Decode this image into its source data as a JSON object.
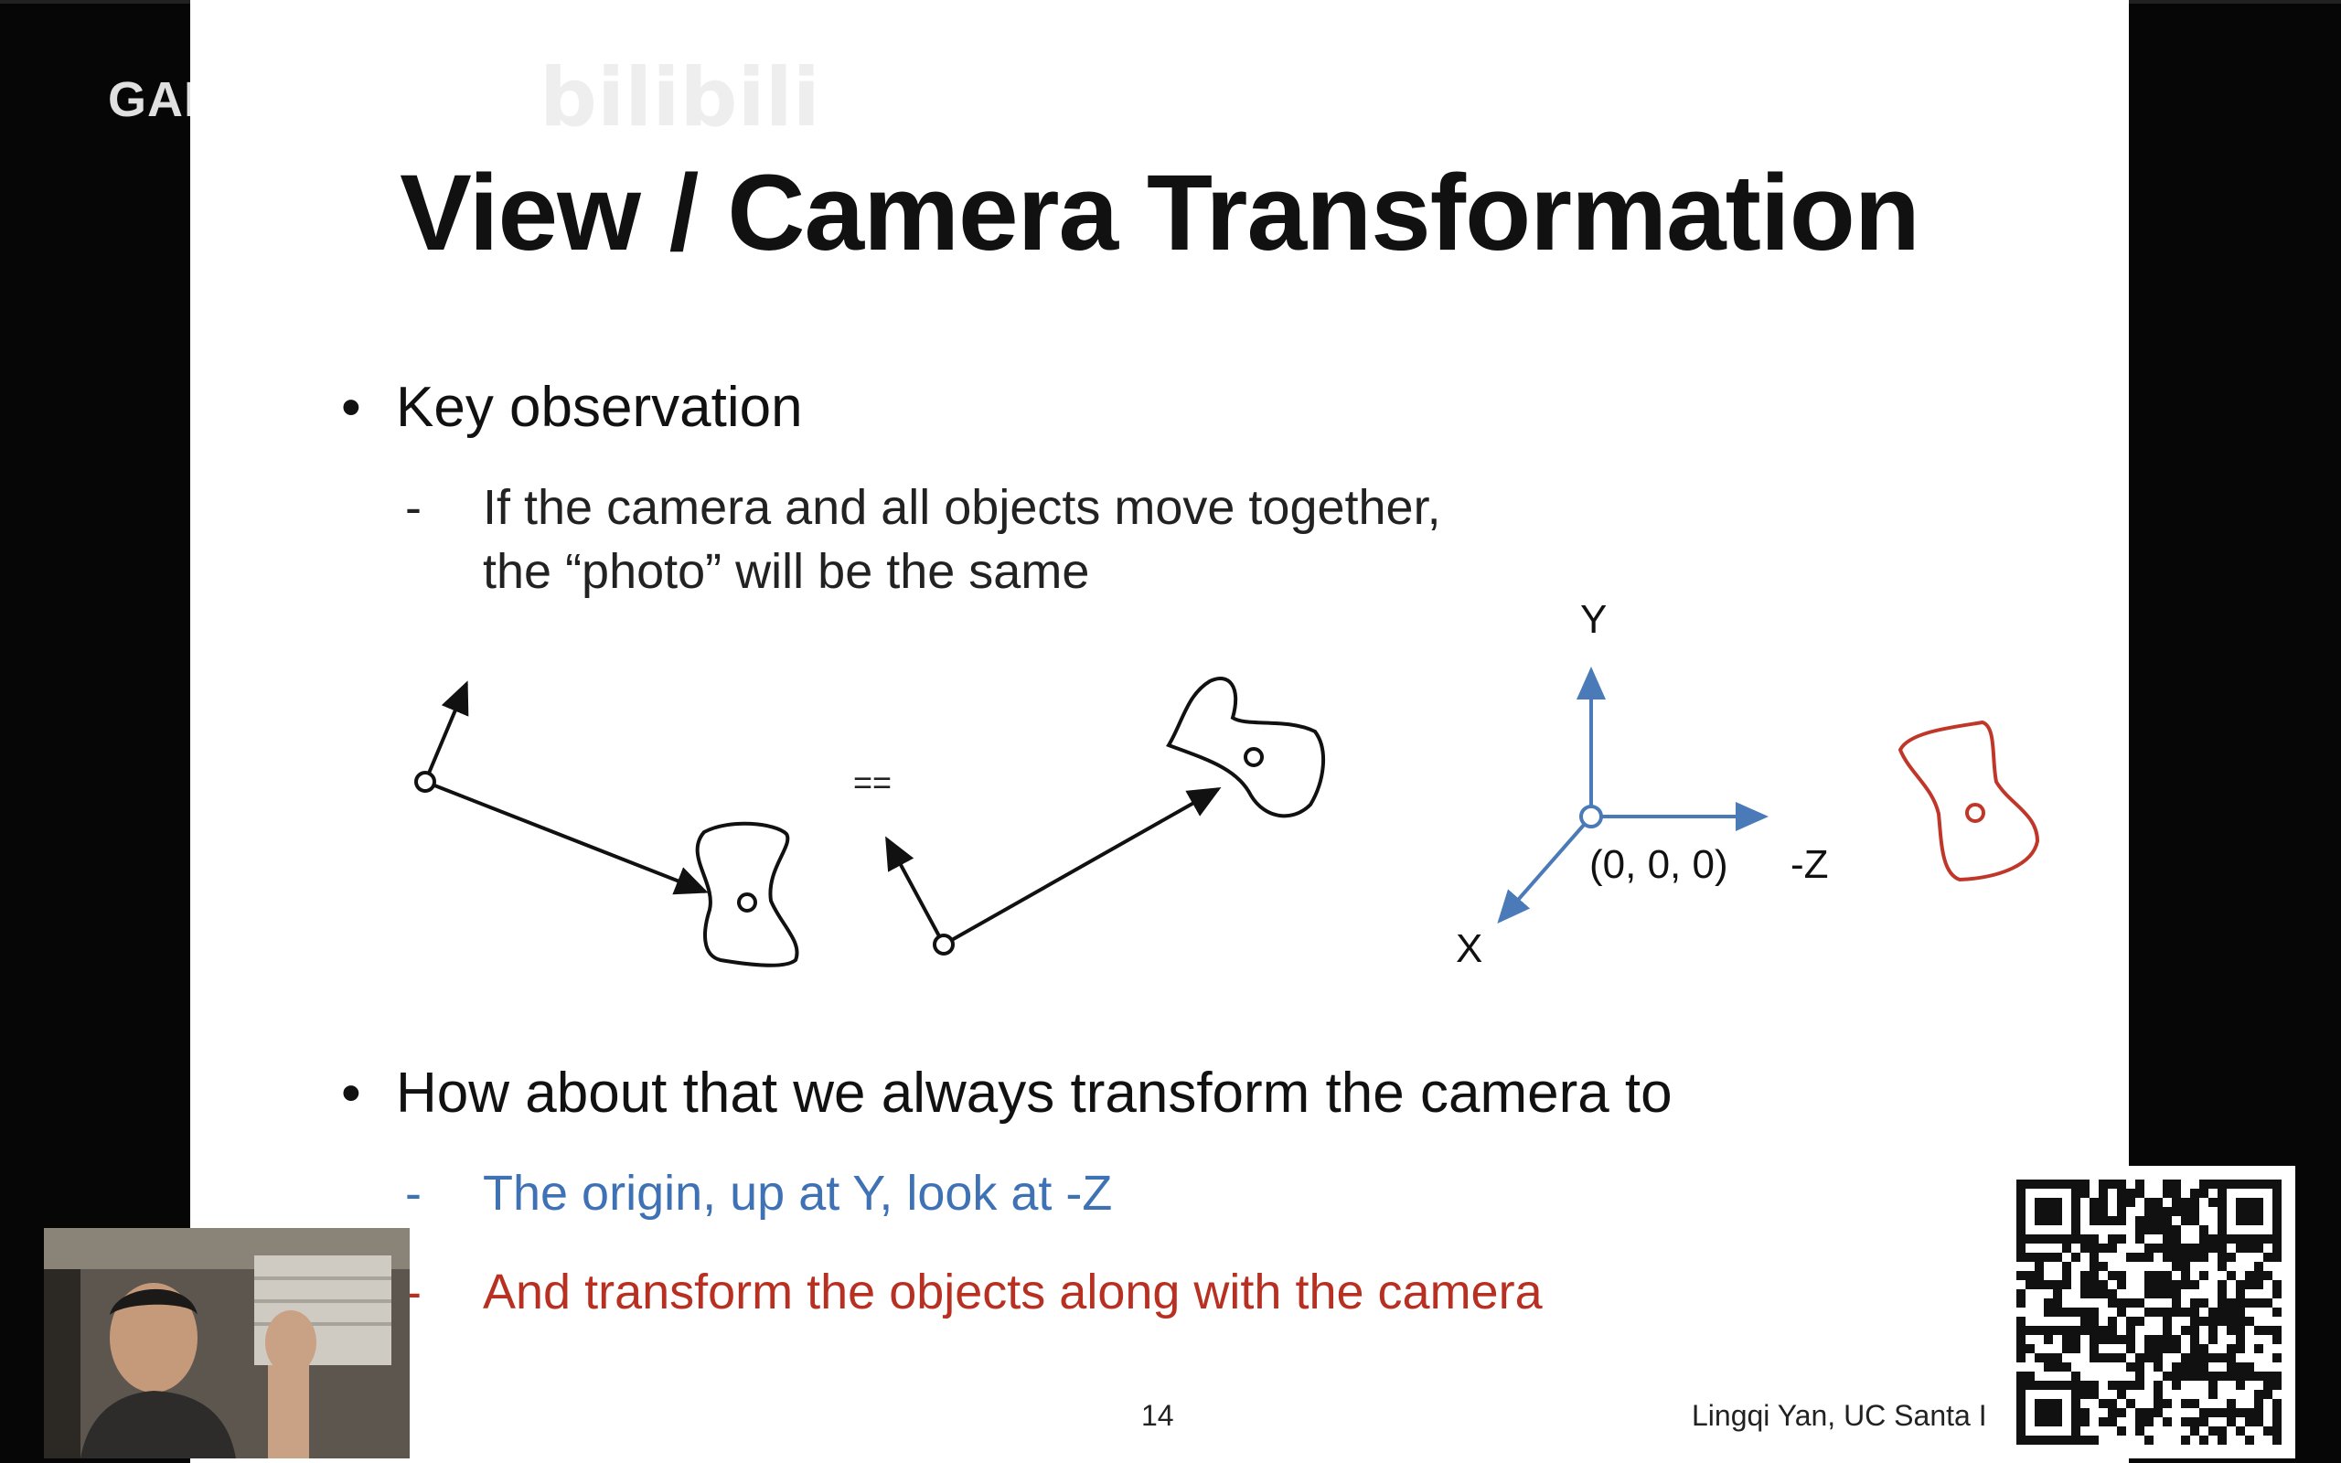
{
  "watermark": {
    "text": "GAMES-Webinar",
    "logo": "bilibili"
  },
  "slide": {
    "title": "View / Camera Transformation",
    "bullet1": "Key observation",
    "sub1_line1": "If the camera and all objects move together,",
    "sub1_line2": "the “photo” will be the same",
    "diagram": {
      "equals": "==",
      "axis_y": "Y",
      "axis_z": "-Z",
      "axis_x": "X",
      "origin": "(0, 0, 0)",
      "colors": {
        "axes": "#4a7ab8",
        "object_red": "#c0372a",
        "ink": "#111111"
      }
    },
    "bullet2": "How about that we always transform the camera to",
    "sub2": "The origin, up at Y, look at -Z",
    "sub3": "And transform the objects along with the camera",
    "dash": "-",
    "bullet_char": "•",
    "page_number": "14",
    "author": "Lingqi Yan, UC Santa I"
  },
  "overlays": {
    "webcam_icon": "presenter-video",
    "qr_icon": "qr-code"
  }
}
